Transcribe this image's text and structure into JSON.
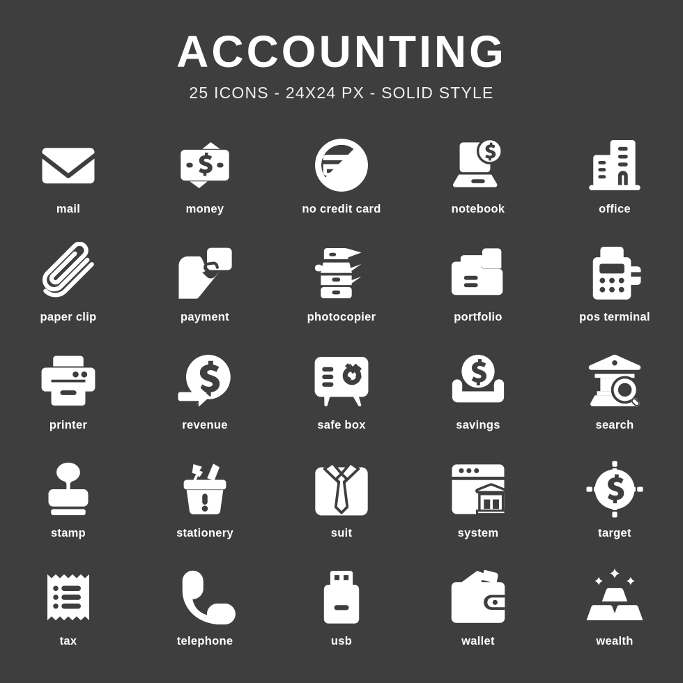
{
  "header": {
    "title": "ACCOUNTING",
    "subtitle": "25 ICONS - 24X24 PX - SOLID STYLE"
  },
  "theme": {
    "background": "#3e3e3e",
    "icon_color": "#ffffff",
    "text_color": "#ffffff"
  },
  "icons": [
    {
      "label": "mail",
      "icon": "mail-icon"
    },
    {
      "label": "money",
      "icon": "money-icon"
    },
    {
      "label": "no credit card",
      "icon": "no-credit-card-icon"
    },
    {
      "label": "notebook",
      "icon": "notebook-icon"
    },
    {
      "label": "office",
      "icon": "office-icon"
    },
    {
      "label": "paper clip",
      "icon": "paper-clip-icon"
    },
    {
      "label": "payment",
      "icon": "payment-icon"
    },
    {
      "label": "photocopier",
      "icon": "photocopier-icon"
    },
    {
      "label": "portfolio",
      "icon": "portfolio-icon"
    },
    {
      "label": "pos terminal",
      "icon": "pos-terminal-icon"
    },
    {
      "label": "printer",
      "icon": "printer-icon"
    },
    {
      "label": "revenue",
      "icon": "revenue-icon"
    },
    {
      "label": "safe box",
      "icon": "safe-box-icon"
    },
    {
      "label": "savings",
      "icon": "savings-icon"
    },
    {
      "label": "search",
      "icon": "search-icon"
    },
    {
      "label": "stamp",
      "icon": "stamp-icon"
    },
    {
      "label": "stationery",
      "icon": "stationery-icon"
    },
    {
      "label": "suit",
      "icon": "suit-icon"
    },
    {
      "label": "system",
      "icon": "system-icon"
    },
    {
      "label": "target",
      "icon": "target-icon"
    },
    {
      "label": "tax",
      "icon": "tax-icon"
    },
    {
      "label": "telephone",
      "icon": "telephone-icon"
    },
    {
      "label": "usb",
      "icon": "usb-icon"
    },
    {
      "label": "wallet",
      "icon": "wallet-icon"
    },
    {
      "label": "wealth",
      "icon": "wealth-icon"
    }
  ]
}
